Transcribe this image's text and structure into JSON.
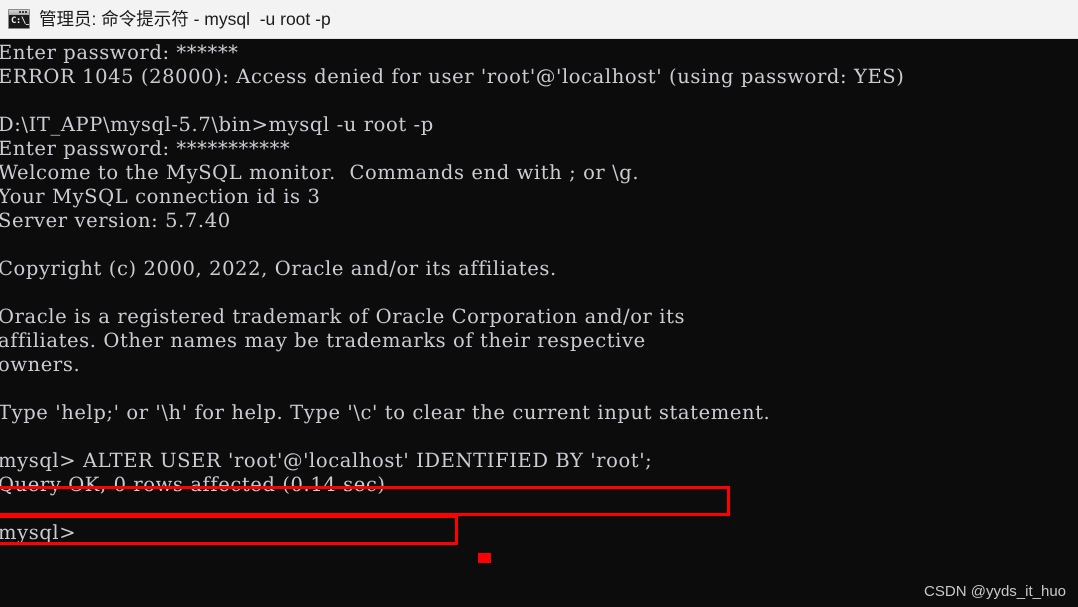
{
  "window": {
    "title": "管理员: 命令提示符 - mysql  -u root -p",
    "icon": "cmd-console-icon",
    "icon_prompt_glyph": "C:\\_",
    "titlebar_bg": "#f3f3f3",
    "titlebar_fg": "#1b1b1b"
  },
  "console": {
    "background": "#0c0c0c",
    "foreground": "#ccccd4",
    "lines": [
      "Enter password: ******",
      "ERROR 1045 (28000): Access denied for user 'root'@'localhost' (using password: YES)",
      "",
      "D:\\IT_APP\\mysql-5.7\\bin>mysql -u root -p",
      "Enter password: ***********",
      "Welcome to the MySQL monitor.  Commands end with ; or \\g.",
      "Your MySQL connection id is 3",
      "Server version: 5.7.40",
      "",
      "Copyright (c) 2000, 2022, Oracle and/or its affiliates.",
      "",
      "Oracle is a registered trademark of Oracle Corporation and/or its",
      "affiliates. Other names may be trademarks of their respective",
      "owners.",
      "",
      "Type 'help;' or '\\h' for help. Type '\\c' to clear the current input statement.",
      "",
      "mysql> ALTER USER 'root'@'localhost' IDENTIFIED BY 'root';",
      "Query OK, 0 rows affected (0.14 sec)",
      "",
      "mysql>"
    ],
    "details": {
      "first_password_mask": "******",
      "second_password_mask": "***********",
      "error_code": "ERROR 1045 (28000)",
      "error_message": "Access denied for user 'root'@'localhost' (using password: YES)",
      "working_directory": "D:\\IT_APP\\mysql-5.7\\bin",
      "launch_command": "mysql -u root -p",
      "connection_id": "3",
      "server_version": "5.7.40",
      "copyright": "Copyright (c) 2000, 2022, Oracle and/or its affiliates.",
      "executed_statement": "ALTER USER 'root'@'localhost' IDENTIFIED BY 'root';",
      "result_status": "Query OK, 0 rows affected (0.14 sec)",
      "prompt": "mysql>"
    }
  },
  "annotations": {
    "color": "#ff0000",
    "boxes": [
      {
        "name": "alter-user-statement",
        "label": "ALTER USER 'root'@'localhost' IDENTIFIED BY 'root';"
      },
      {
        "name": "query-ok-result",
        "label": "Query OK, 0 rows affected (0.14 sec)"
      }
    ],
    "marker": {
      "name": "cursor-marker",
      "color": "#ff0000"
    }
  },
  "watermark": {
    "text": "CSDN @yyds_it_huo"
  }
}
